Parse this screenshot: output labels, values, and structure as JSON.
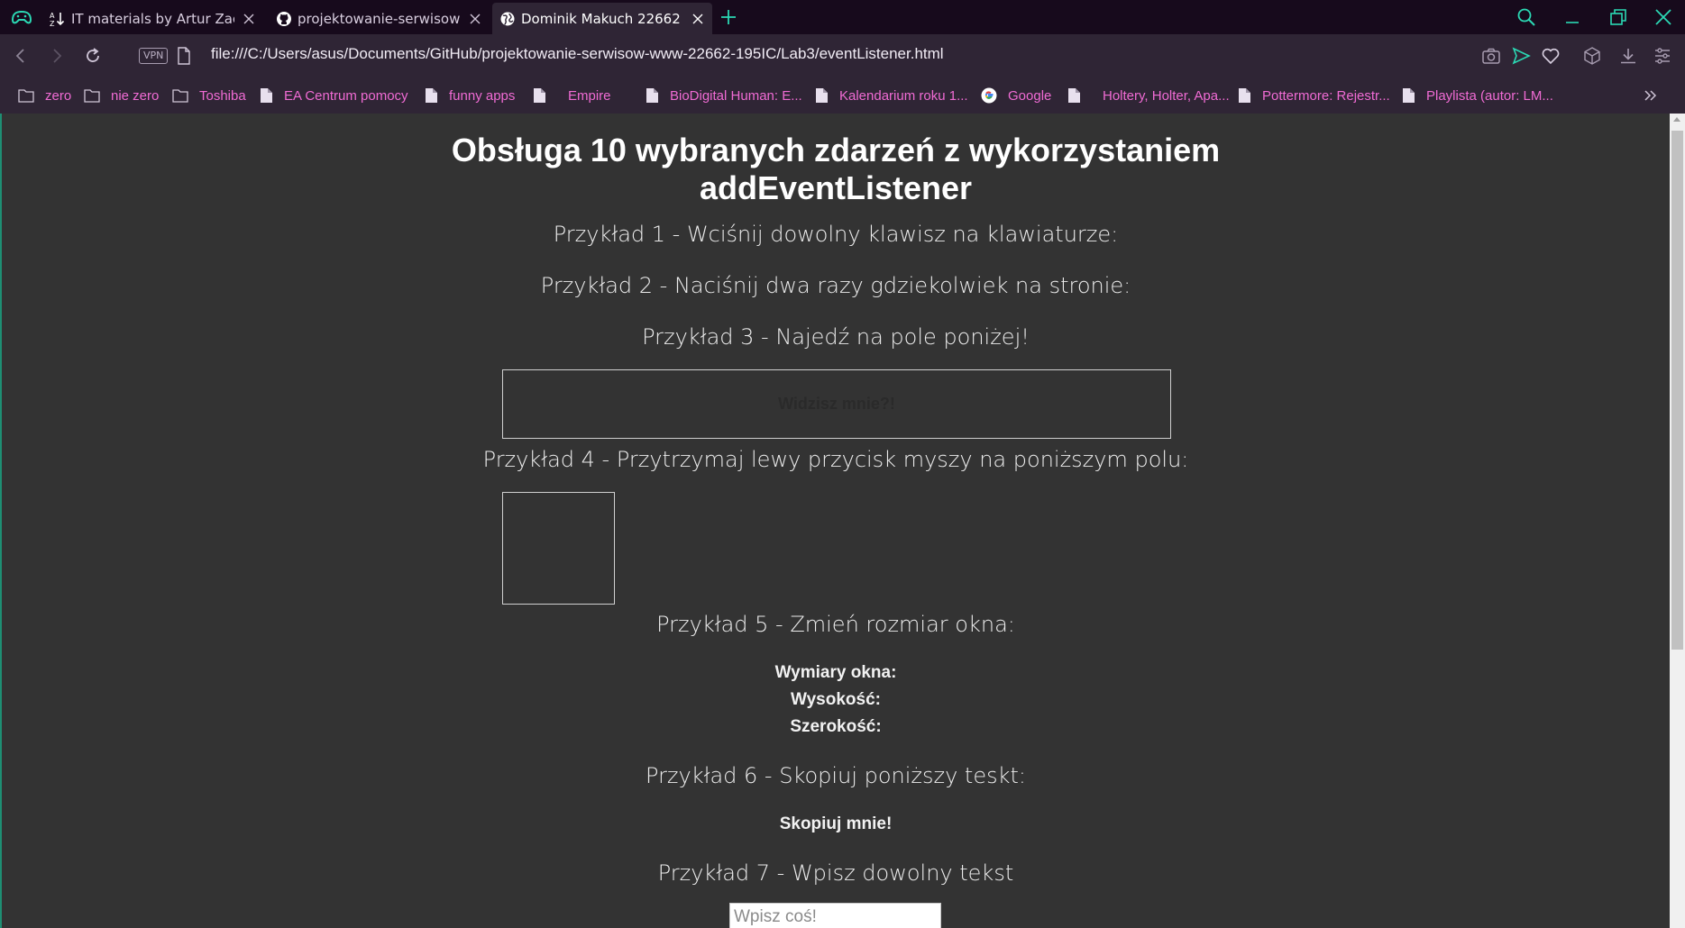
{
  "browser": {
    "tabs": [
      {
        "title": "IT materials by Artur Zacniewski",
        "favicon": "az-sort-icon",
        "active": false
      },
      {
        "title": "projektowanie-serwisow-www",
        "favicon": "github-icon",
        "active": false
      },
      {
        "title": "Dominik Makuch 22662",
        "favicon": "globe-icon",
        "active": true
      }
    ],
    "address": {
      "vpn_label": "VPN",
      "url": "file:///C:/Users/asus/Documents/GitHub/projektowanie-serwisow-www-22662-195IC/Lab3/eventListener.html"
    },
    "bookmarks": [
      {
        "label": "zero",
        "icon": "folder-icon"
      },
      {
        "label": "nie zero",
        "icon": "folder-icon"
      },
      {
        "label": "Toshiba",
        "icon": "folder-icon"
      },
      {
        "label": "EA Centrum pomocy",
        "icon": "page-icon"
      },
      {
        "label": "funny apps",
        "icon": "page-icon"
      },
      {
        "label": "Empire",
        "icon": "page-icon"
      },
      {
        "label": "BioDigital Human: E...",
        "icon": "page-icon"
      },
      {
        "label": "Kalendarium roku 1...",
        "icon": "page-icon"
      },
      {
        "label": "Google",
        "icon": "google-icon"
      },
      {
        "label": "Holtery, Holter, Apa...",
        "icon": "page-icon"
      },
      {
        "label": "Pottermore: Rejestr...",
        "icon": "page-icon"
      },
      {
        "label": "Playlista (autor: LM...",
        "icon": "page-icon"
      }
    ],
    "colors": {
      "tabbar": "#170a1c",
      "toolbar": "#2f2535",
      "bookmark_text": "#f06bd4",
      "accent": "#2bd9b4"
    }
  },
  "page": {
    "heading_line1": "Obsługa 10 wybranych zdarzeń z wykorzystaniem",
    "heading_line2": "addEventListener",
    "ex1": "Przykład 1 - Wciśnij dowolny klawisz na klawiaturze:",
    "ex2": "Przykład 2 - Naciśnij dwa razy gdziekolwiek na stronie:",
    "ex3": "Przykład 3 - Najedź na pole poniżej!",
    "ex3_box": "Widzisz mnie?!",
    "ex4": "Przykład 4 - Przytrzymaj lewy przycisk myszy na poniższym polu:",
    "ex5": "Przykład 5 - Zmień rozmiar okna:",
    "ex5_dims": "Wymiary okna:",
    "ex5_height": "Wysokość:",
    "ex5_width": "Szerokość:",
    "ex6": "Przykład 6 - Skopiuj poniższy teskt:",
    "ex6_text": "Skopiuj mnie!",
    "ex7": "Przykład 7 - Wpisz dowolny tekst",
    "ex7_placeholder": "Wpisz coś!"
  }
}
